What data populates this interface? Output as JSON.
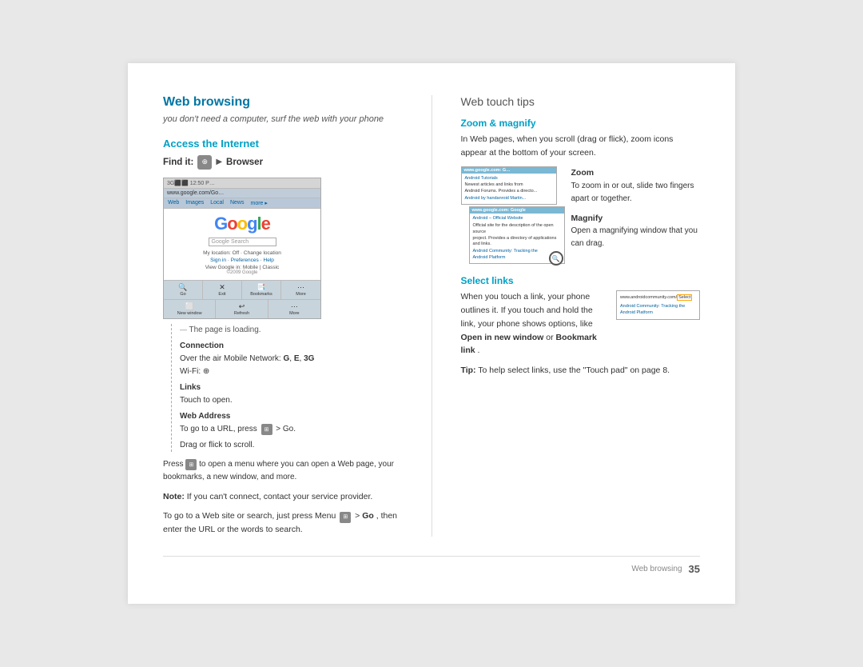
{
  "page": {
    "background": "#f0f0f0"
  },
  "left": {
    "section_title": "Web browsing",
    "subtitle": "you don't need a computer, surf the web with your phone",
    "access_title": "Access the Internet",
    "find_it_label": "Find it:",
    "find_it_icon": "⊕",
    "find_it_arrow": "▶",
    "find_it_browser": "Browser",
    "loading_text": "The page is loading.",
    "callouts": {
      "connection_label": "Connection",
      "connection_text": "Over the air Mobile Network: G, E, 3G\nWi-Fi: ⊕",
      "links_label": "Links",
      "links_text": "Touch to open.",
      "web_address_label": "Web Address",
      "web_address_text": "To go to a URL, press",
      "web_address_icon": "⊞",
      "web_address_go": " > Go.",
      "drag_text": "Drag or flick to scroll."
    },
    "browser_bottom": {
      "items": [
        {
          "icon": "🔍",
          "label": "Go"
        },
        {
          "icon": "✕",
          "label": "Exit"
        },
        {
          "icon": "📑",
          "label": "Bookmarks"
        },
        {
          "icon": "⬜",
          "label": "New window"
        },
        {
          "icon": "↩",
          "label": "Refresh"
        },
        {
          "icon": "⋯",
          "label": "More"
        }
      ]
    },
    "press_menu_text": "Press ⊞ to open a menu where you can open a Web page, your bookmarks, a new window, and more.",
    "note_label": "Note:",
    "note_text": " If you can't connect, contact your service provider.",
    "go_to_text": "To go to a Web site or search, just press Menu",
    "go_label": "Go",
    "go_text": ", then enter the URL or the words to search."
  },
  "right": {
    "section_title": "Web touch tips",
    "zoom_title": "Zoom & magnify",
    "zoom_intro": "In Web pages, when you scroll (drag or flick), zoom icons appear at the bottom of your screen.",
    "zoom_label": "Zoom",
    "zoom_text": "To zoom in or out, slide two fingers apart or together.",
    "magnify_label": "Magnify",
    "magnify_text": "Open a magnifying window that you can drag.",
    "select_links_title": "Select links",
    "select_links_intro": "When you touch a link, your phone outlines it. If you touch and hold the link, your phone shows options, like",
    "open_in_new_window": "Open in new window",
    "select_links_mid": " or ",
    "bookmark_link": "Bookmark link",
    "select_links_end": ".",
    "tip_label": "Tip:",
    "tip_text": " To help select links, use the \"Touch pad\" on page 8."
  },
  "footer": {
    "left_text": "Web browsing",
    "page_number": "35"
  }
}
